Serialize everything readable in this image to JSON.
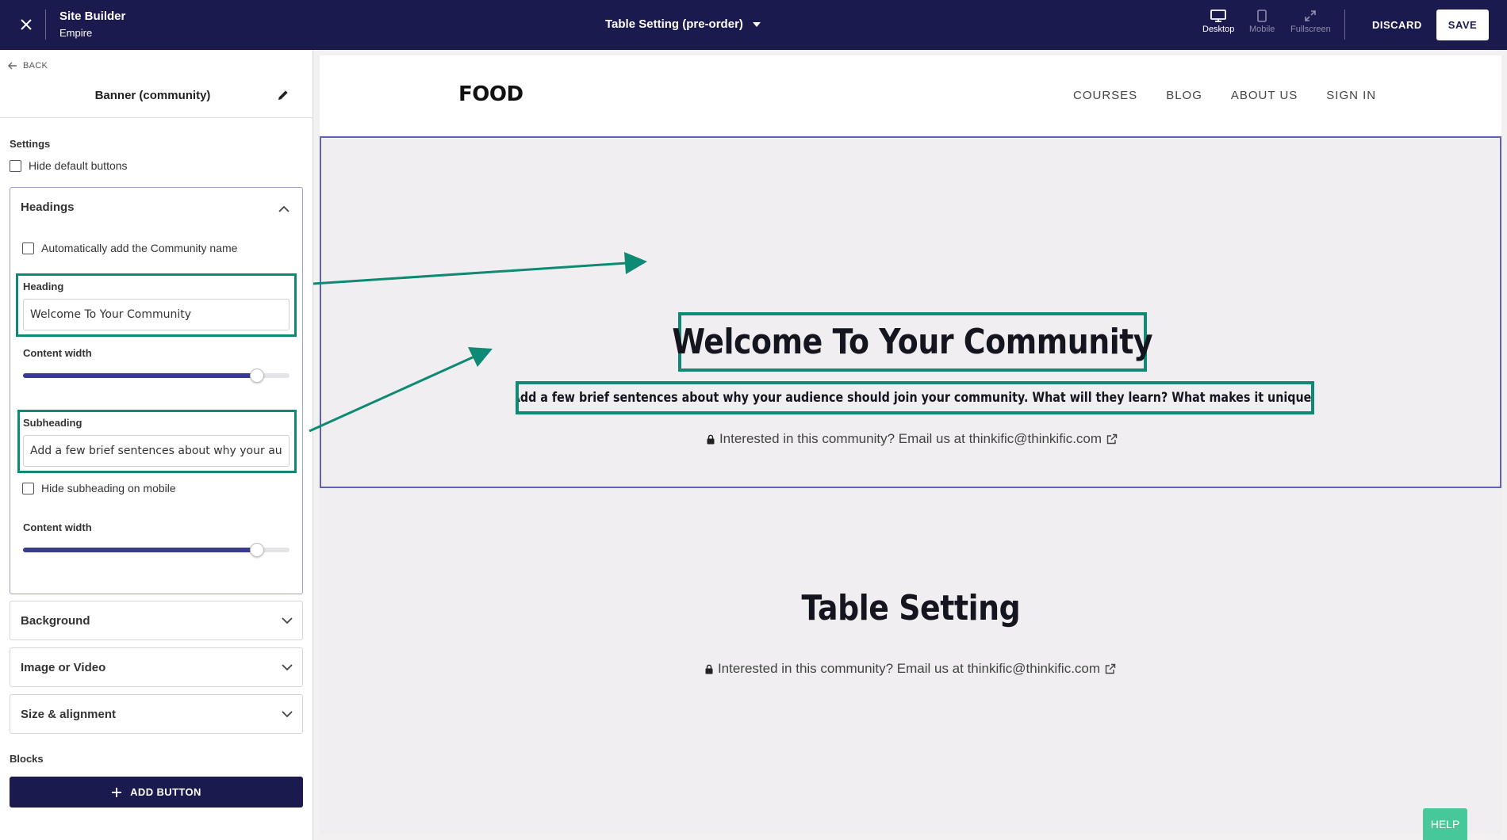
{
  "topbar": {
    "app_title": "Site Builder",
    "app_subtitle": "Empire",
    "page_selector": "Table Setting (pre-order)",
    "views": [
      "Desktop",
      "Mobile",
      "Fullscreen"
    ],
    "discard_label": "DISCARD",
    "save_label": "SAVE",
    "icons": [
      "close-icon",
      "caret-down-icon",
      "desktop-icon",
      "mobile-icon",
      "fullscreen-icon"
    ]
  },
  "sidebar": {
    "back_label": "BACK",
    "panel_title": "Banner (community)",
    "settings_label": "Settings",
    "hide_default_buttons": "Hide default buttons",
    "headings_section": {
      "title": "Headings",
      "auto_community_name": "Automatically add the Community name",
      "heading_label": "Heading",
      "heading_value": "Welcome To Your Community",
      "content_width_label": "Content width",
      "content_width_value": 0.88,
      "subheading_label": "Subheading",
      "subheading_value": "Add a few brief sentences about why your audience should join your community. What will they learn? What makes it unique?",
      "hide_subheading_mobile": "Hide subheading on mobile",
      "content_width_label_2": "Content width",
      "content_width_value_2": 0.88
    },
    "collapsed_sections": [
      "Background",
      "Image or Video",
      "Size & alignment"
    ],
    "blocks_label": "Blocks",
    "add_button_label": "ADD BUTTON"
  },
  "preview": {
    "logo": "FOOD",
    "nav": [
      "COURSES",
      "BLOG",
      "ABOUT US",
      "SIGN IN"
    ],
    "banner_heading": "Welcome To Your Community",
    "banner_subheading": "Add a few brief sentences about why your audience should join your community. What will they learn? What makes it unique?",
    "info_text": "Interested in this community? Email us at thinkific@thinkific.com",
    "second_heading": "Table Setting",
    "second_info_text": "Interested in this community? Email us at thinkific@thinkific.com"
  },
  "help_label": "HELP",
  "colors": {
    "topbar": "#1b1a4e",
    "highlight": "#0e8a74",
    "slider_fill": "#3a3a93",
    "banner_border": "#5f62b8",
    "help": "#46c89a"
  }
}
